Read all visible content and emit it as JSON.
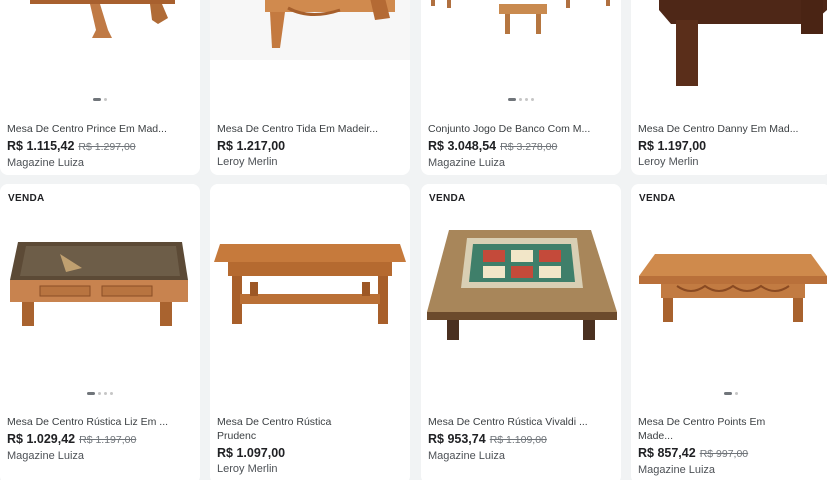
{
  "products": [
    {
      "title": "Mesa De Centro Prince Em Mad...",
      "price": "R$ 1.115,42",
      "old_price": "R$ 1.297,00",
      "store": "Magazine Luiza"
    },
    {
      "title": "Mesa De Centro Tida Em Madeir...",
      "price": "R$ 1.217,00",
      "old_price": "",
      "store": "Leroy Merlin"
    },
    {
      "title": "Conjunto Jogo De Banco Com M...",
      "price": "R$ 3.048,54",
      "old_price": "R$ 3.278,00",
      "store": "Magazine Luiza"
    },
    {
      "title": "Mesa De Centro Danny Em Mad...",
      "price": "R$ 1.197,00",
      "old_price": "",
      "store": "Leroy Merlin"
    },
    {
      "badge": "VENDA",
      "title": "Mesa De Centro Rústica Liz Em ...",
      "price": "R$ 1.029,42",
      "old_price": "R$ 1.197,00",
      "store": "Magazine Luiza"
    },
    {
      "title_line1": "Mesa De Centro Rústica",
      "title_line2": "Prudenc",
      "price": "R$ 1.097,00",
      "old_price": "",
      "store": "Leroy Merlin"
    },
    {
      "badge": "VENDA",
      "title": "Mesa De Centro Rústica Vivaldi ...",
      "price": "R$ 953,74",
      "old_price": "R$ 1.109,00",
      "store": "Magazine Luiza"
    },
    {
      "badge": "VENDA",
      "title_line1": "Mesa De Centro Points Em",
      "title_line2": "Made...",
      "price": "R$ 857,42",
      "old_price": "R$ 997,00",
      "store": "Magazine Luiza"
    }
  ],
  "colors": {
    "background": "#f1f3f4",
    "card": "#ffffff",
    "wood": "#b5703a",
    "wood_dark": "#5a2e1a",
    "strike": "#70757a"
  },
  "icons": [
    "carousel-dots-icon"
  ]
}
